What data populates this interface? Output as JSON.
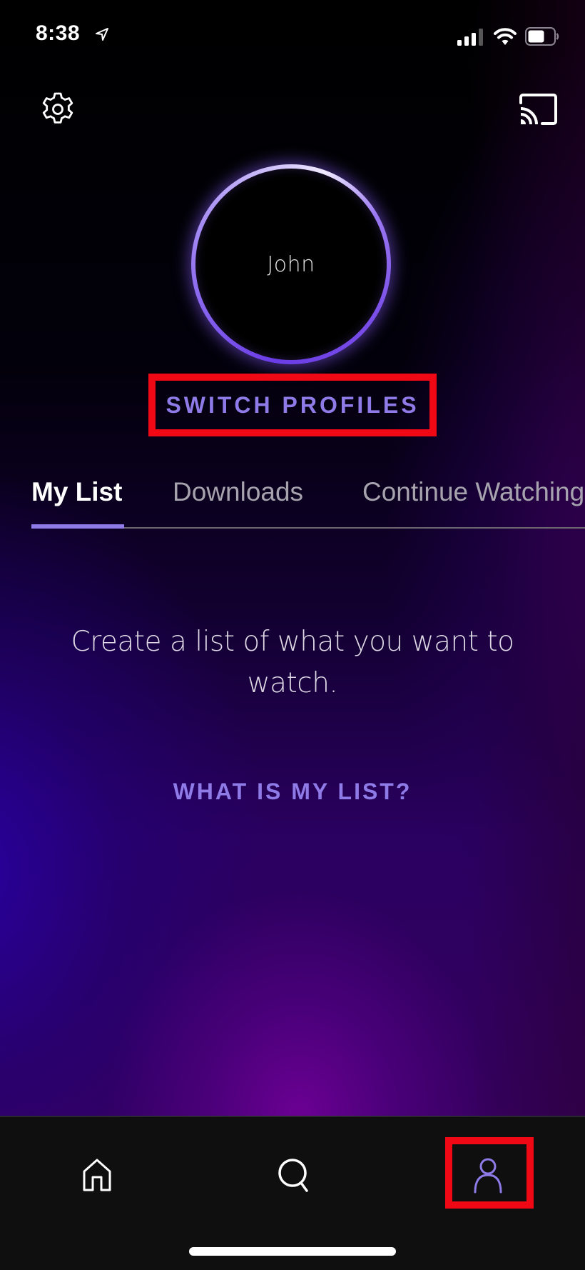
{
  "status_bar": {
    "time": "8:38",
    "location_icon": "location-arrow-icon",
    "signal_icon": "cellular-signal-icon",
    "signal_bars_active": 3,
    "signal_bars_total": 4,
    "wifi_icon": "wifi-icon",
    "battery_icon": "battery-icon",
    "battery_level": 0.6
  },
  "header": {
    "settings_icon": "gear-icon",
    "cast_icon": "cast-icon"
  },
  "profile": {
    "name": "John",
    "ring_color": "#7a4fe8",
    "switch_label": "SWITCH PROFILES"
  },
  "tabs": [
    {
      "label": "My List",
      "active": true
    },
    {
      "label": "Downloads",
      "active": false
    },
    {
      "label": "Continue Watching",
      "active": false
    }
  ],
  "empty_state": {
    "message": "Create a list of what you want to watch.",
    "link_label": "WHAT IS MY LIST?"
  },
  "bottom_nav": {
    "items": [
      {
        "name": "home",
        "icon": "home-icon",
        "active": false
      },
      {
        "name": "search",
        "icon": "search-icon",
        "active": false
      },
      {
        "name": "profile",
        "icon": "user-icon",
        "active": true
      }
    ]
  },
  "annotations": {
    "highlight_color": "#f00814",
    "highlighted": [
      "switch-profiles-button",
      "nav-profile"
    ]
  },
  "colors": {
    "accent": "#8f7be8",
    "inactive_tab": "#a7a3ae",
    "nav_background": "#0f0f10"
  }
}
